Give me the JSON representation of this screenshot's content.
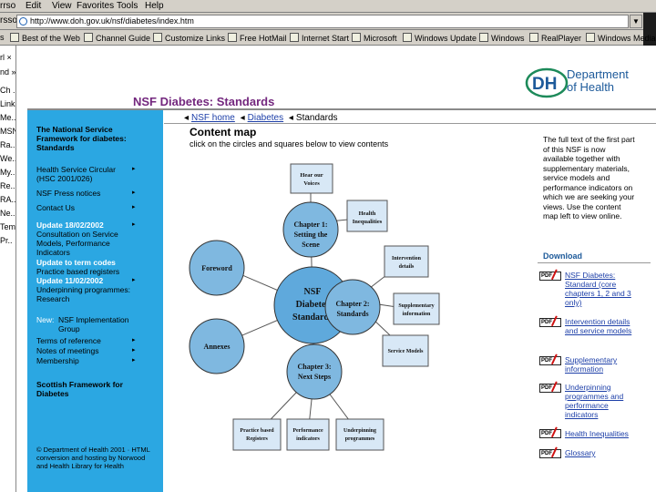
{
  "browser": {
    "menu": [
      "rrso",
      "Edit",
      "View",
      "Favorites",
      "Tools",
      "Help"
    ],
    "address_label": "rsso",
    "url": "http://www.doh.gov.uk/nsf/diabetes/index.htm",
    "links_label": "s",
    "links": [
      "Best of the Web",
      "Channel Guide",
      "Customize Links",
      "Free HotMail",
      "Internet Start",
      "Microsoft",
      "Windows Update",
      "Windows",
      "RealPlayer",
      "Windows Media"
    ]
  },
  "explorer": {
    "items": [
      "rl ×",
      "nd »",
      "Ch .",
      "Links",
      "Me...",
      "MSN",
      "Ra..",
      "We...",
      "My...",
      "Re..",
      "RA..",
      "Ne..",
      "Temp",
      "Pr.."
    ]
  },
  "header": {
    "logo_letters": "DH",
    "org_line1": "Department",
    "org_line2": "of Health",
    "page_title": "NSF Diabetes: Standards"
  },
  "sidebar": {
    "items": [
      {
        "text": "The National Service Framework for diabetes: Standards",
        "style": "bold"
      },
      {
        "text": "Health Service Circular (HSC 2001/026)",
        "arrow": "▸"
      },
      {
        "text": "NSF Press notices",
        "arrow": "▸"
      },
      {
        "text": "Contact Us",
        "arrow": "▸"
      },
      {
        "text": "Update 18/02/2002",
        "style": "bold-white",
        "arrow": "▸"
      },
      {
        "text": "Consultation on Service Models, Performance Indicators"
      },
      {
        "text": "Update to term codes",
        "style": "bold-white"
      },
      {
        "text": "Practice based registers"
      },
      {
        "text": "Update 11/02/2002",
        "style": "bold-white",
        "arrow": "▸"
      },
      {
        "text": "Underpinning programmes: Research"
      },
      {
        "text": "New:",
        "style": "white-inline"
      },
      {
        "text": "NSF Implementation Group"
      },
      {
        "text": "Terms of reference",
        "arrow": "▸"
      },
      {
        "text": "Notes of meetings",
        "arrow": "▸"
      },
      {
        "text": "Membership",
        "arrow": "▸"
      },
      {
        "text": "Scottish Framework for Diabetes",
        "style": "bold"
      },
      {
        "text": "© Department of Health 2001 · HTML conversion and hosting by Norwood and Health Library for Health",
        "style": "small"
      }
    ]
  },
  "breadcrumb": {
    "items": [
      "NSF home",
      "Diabetes",
      "Standards"
    ],
    "prefix": "◂"
  },
  "content": {
    "title": "Content map",
    "subtitle": "click on the circles and squares below to view contents"
  },
  "diagram": {
    "center": [
      "NSF",
      "Diabetes",
      "Standards"
    ],
    "foreword": "Foreword",
    "annexes": "Annexes",
    "chapter1": [
      "Chapter 1:",
      "Setting the",
      "Scene"
    ],
    "chapter2": [
      "Chapter 2:",
      "Standards"
    ],
    "chapter3": [
      "Chapter 3:",
      "Next Steps"
    ],
    "hear_voices": [
      "Hear our",
      "Voices"
    ],
    "health_inequalities": [
      "Health",
      "Inequalities"
    ],
    "intervention": [
      "Intervention",
      "details"
    ],
    "supplementary": [
      "Supplementary",
      "information"
    ],
    "service_models": "Service Models",
    "practice_registers": [
      "Practice based",
      "Registers"
    ],
    "performance": [
      "Performance",
      "indicators"
    ],
    "underpinning": [
      "Underpinning",
      "programmes"
    ],
    "colors": {
      "circle": "#7fb8e0",
      "center": "#5fa9dc",
      "box": "#d8e8f6",
      "line": "#555555"
    }
  },
  "right": {
    "intro": "The full text of the first part of this NSF is now available together with supplementary materials, service models and performance indicators on which we are seeking your views. Use the content map left to view online.",
    "download_title": "Download",
    "pdf_label": "PDF",
    "downloads": [
      "NSF Diabetes: Standard (core chapters 1, 2 and 3 only)",
      "Intervention details and service models",
      "Supplementary information",
      "Underpinning programmes and performance indicators",
      "Health Inequalities",
      "Glossary"
    ]
  }
}
